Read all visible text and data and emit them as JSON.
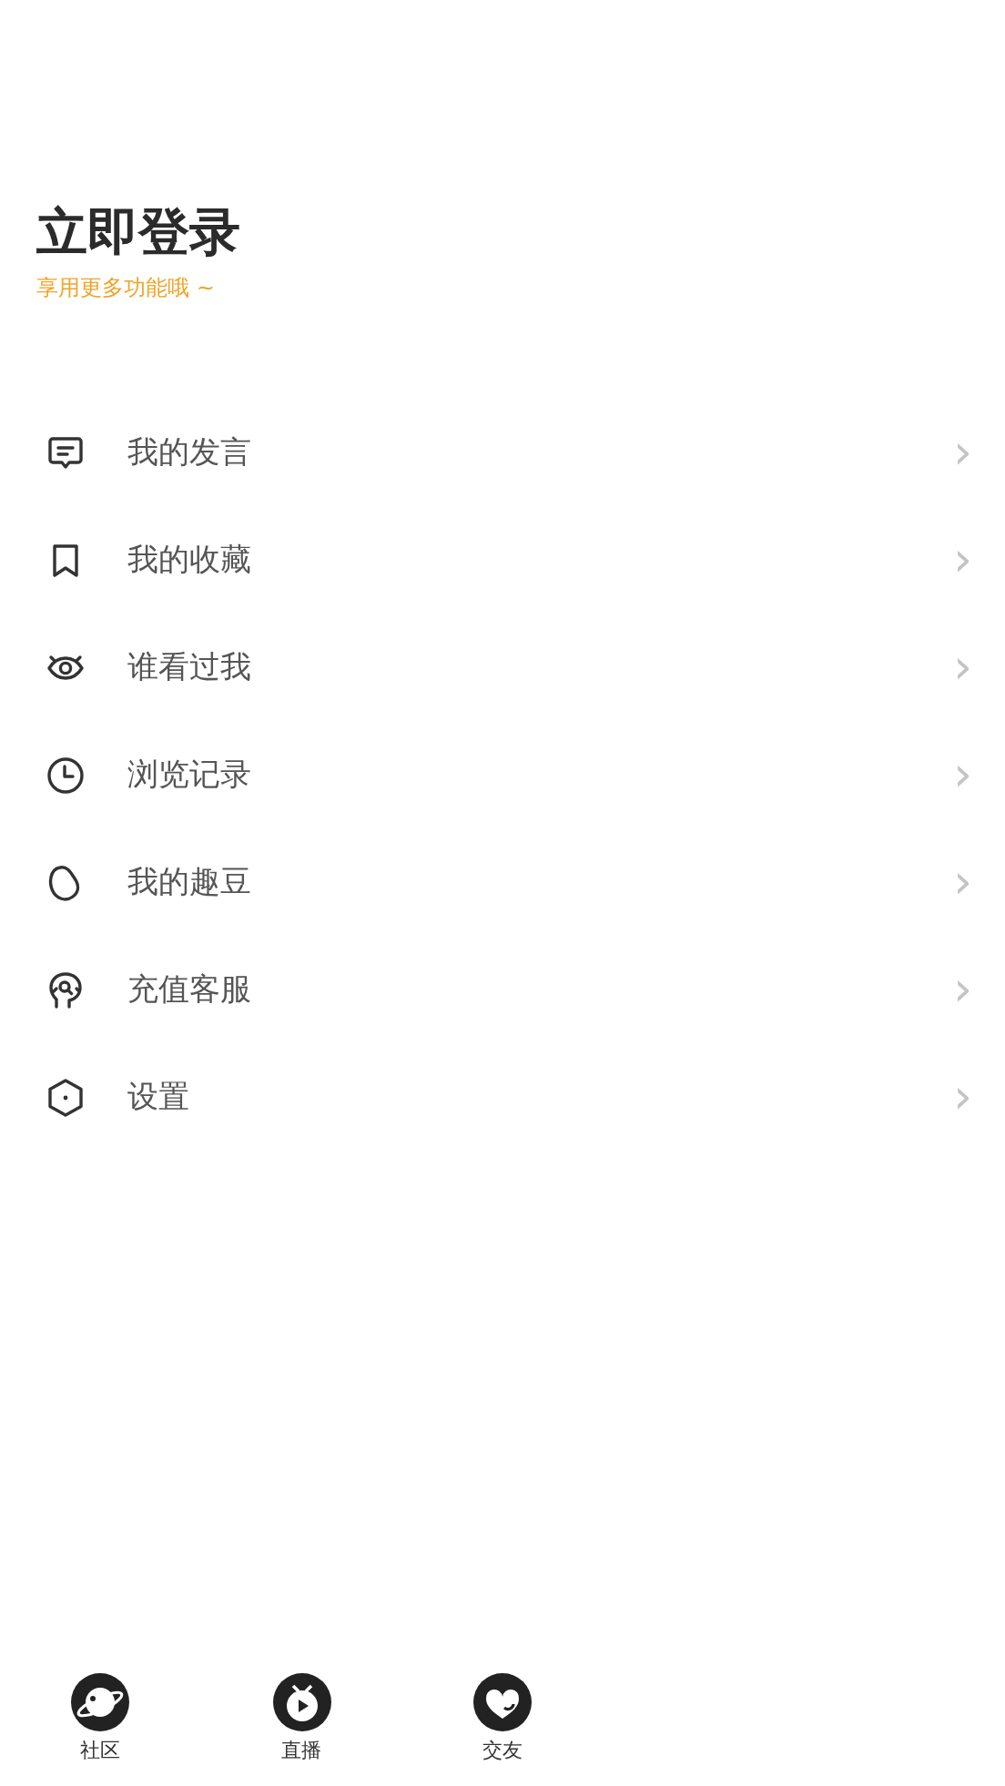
{
  "header": {
    "title": "立即登录",
    "subtitle": "享用更多功能哦 ~"
  },
  "menu": [
    {
      "kind": "comment",
      "label": "我的发言",
      "arrow": "›"
    },
    {
      "kind": "bookmark",
      "label": "我的收藏",
      "arrow": "›"
    },
    {
      "kind": "eye",
      "label": "谁看过我",
      "arrow": "›"
    },
    {
      "kind": "clock",
      "label": "浏览记录",
      "arrow": "›"
    },
    {
      "kind": "bean",
      "label": "我的趣豆",
      "arrow": "›"
    },
    {
      "kind": "service",
      "label": "充值客服",
      "arrow": "›"
    },
    {
      "kind": "settings",
      "label": "设置",
      "arrow": "›"
    }
  ],
  "tab_bar": [
    {
      "kind": "planet",
      "label": "社区"
    },
    {
      "kind": "play",
      "label": "直播"
    },
    {
      "kind": "heart",
      "label": "交友"
    }
  ]
}
